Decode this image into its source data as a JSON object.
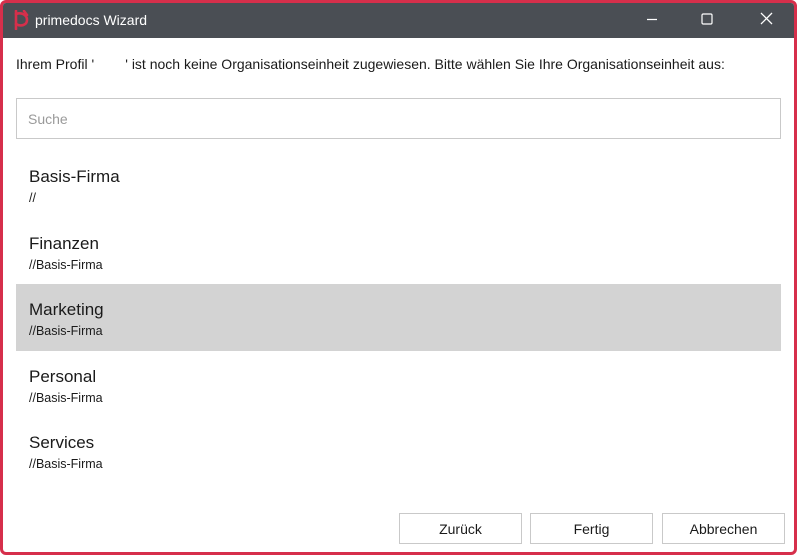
{
  "window": {
    "title": "primedocs Wizard",
    "brand_color": "#d62f4b",
    "titlebar_color": "#4a4e54",
    "controls": [
      "minimize-icon",
      "maximize-icon",
      "close-icon"
    ]
  },
  "intro_text": "Ihrem Profil '        ' ist noch keine Organisationseinheit zugewiesen. Bitte wählen Sie Ihre Organisationseinheit aus:",
  "search": {
    "placeholder": "Suche",
    "value": ""
  },
  "org_units": [
    {
      "name": "Basis-Firma",
      "path": "//",
      "selected": false
    },
    {
      "name": "Finanzen",
      "path": "//Basis-Firma",
      "selected": false
    },
    {
      "name": "Marketing",
      "path": "//Basis-Firma",
      "selected": true
    },
    {
      "name": "Personal",
      "path": "//Basis-Firma",
      "selected": false
    },
    {
      "name": "Services",
      "path": "//Basis-Firma",
      "selected": false
    }
  ],
  "selection_color": "#d3d3d3",
  "buttons": {
    "back": "Zurück",
    "finish": "Fertig",
    "cancel": "Abbrechen"
  }
}
